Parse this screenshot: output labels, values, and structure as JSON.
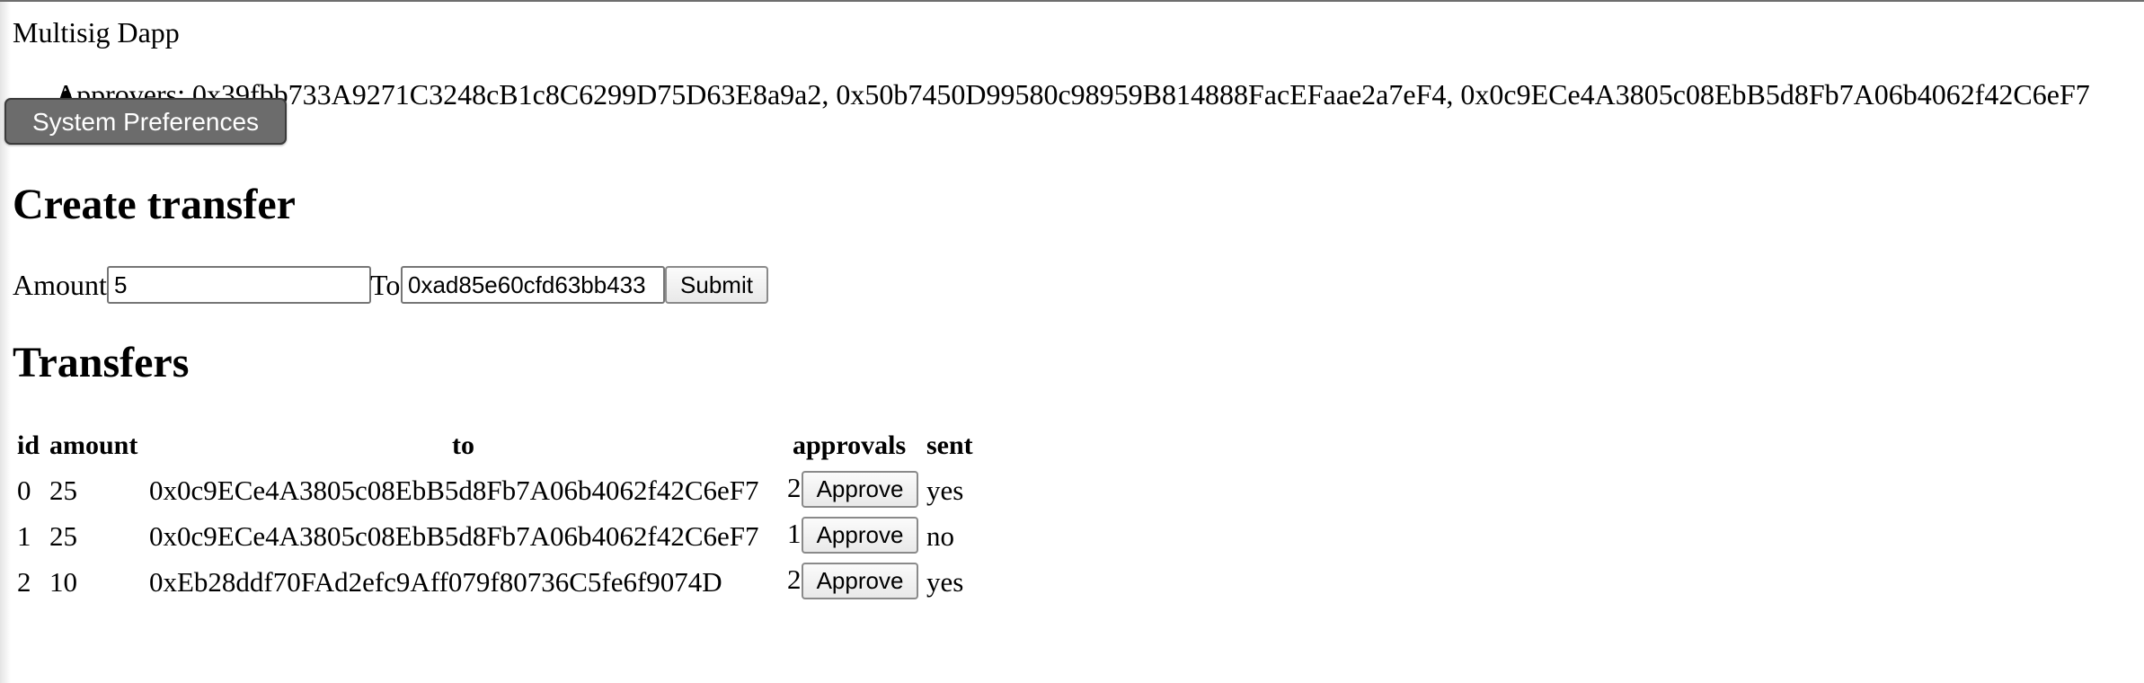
{
  "app": {
    "title": "Multisig Dapp"
  },
  "approvers": {
    "text": "Approvers: 0x39fbb733A9271C3248cB1c8C6299D75D63E8a9a2, 0x50b7450D99580c98959B814888FacEFaae2a7eF4, 0x0c9ECe4A3805c08EbB5d8Fb7A06b4062f42C6eF7"
  },
  "overlay": {
    "system_preferences_label": "System Preferences"
  },
  "create_transfer": {
    "heading": "Create transfer",
    "amount_label": "Amount",
    "amount_value": "5",
    "to_label": "To",
    "to_value": "0xad85e60cfd63bb433",
    "submit_label": "Submit"
  },
  "transfers": {
    "heading": "Transfers",
    "columns": [
      "id",
      "amount",
      "to",
      "approvals",
      "sent"
    ],
    "approve_label": "Approve",
    "rows": [
      {
        "id": "0",
        "amount": "25",
        "to": "0x0c9ECe4A3805c08EbB5d8Fb7A06b4062f42C6eF7",
        "approvals": "2",
        "sent": "yes"
      },
      {
        "id": "1",
        "amount": "25",
        "to": "0x0c9ECe4A3805c08EbB5d8Fb7A06b4062f42C6eF7",
        "approvals": "1",
        "sent": "no"
      },
      {
        "id": "2",
        "amount": "10",
        "to": "0xEb28ddf70FAd2efc9Aff079f80736C5fe6f9074D",
        "approvals": "2",
        "sent": "yes"
      }
    ]
  }
}
